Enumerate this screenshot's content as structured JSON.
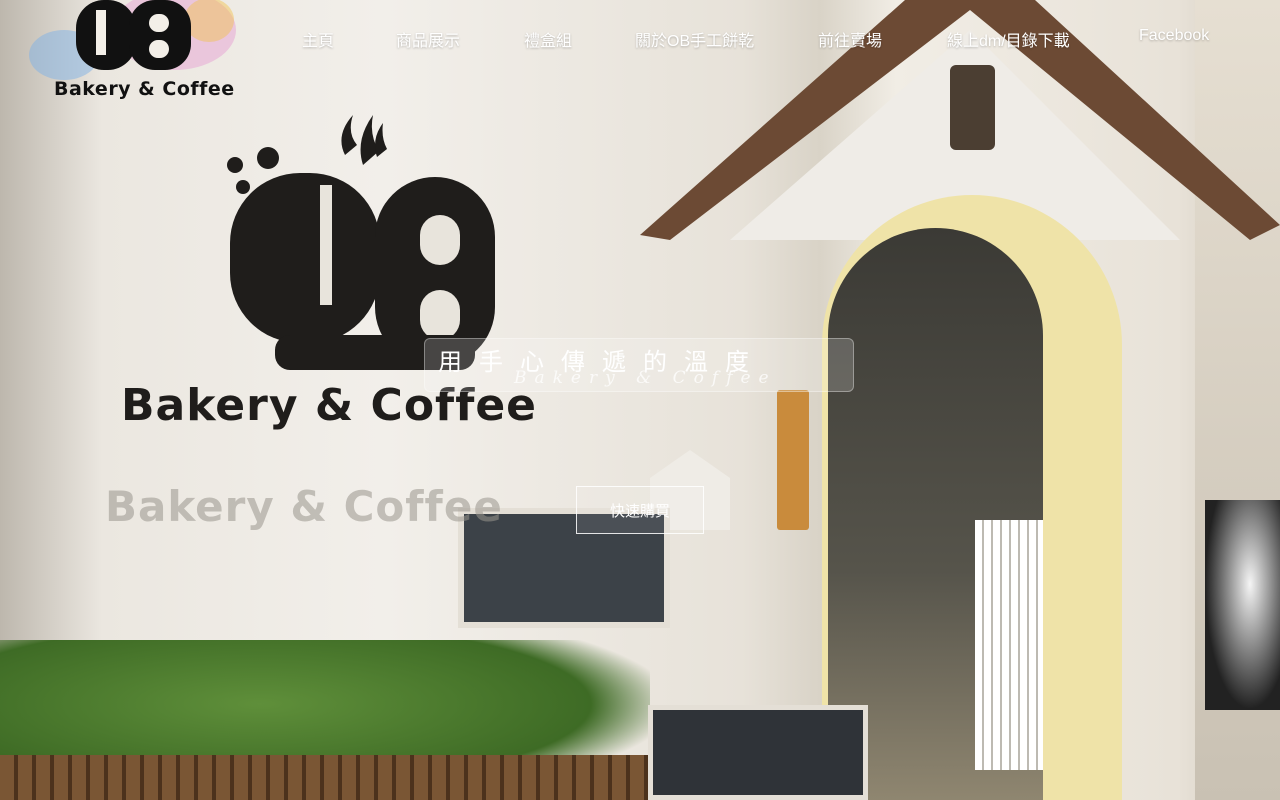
{
  "nav": {
    "items": [
      {
        "label": "主頁"
      },
      {
        "label": "商品展示"
      },
      {
        "label": "禮盒組"
      },
      {
        "label": "關於OB手工餅乾"
      },
      {
        "label": "前往賣場"
      },
      {
        "label": "線上dm/目錄下載"
      },
      {
        "label": "Facebook"
      }
    ]
  },
  "logo": {
    "text": "Bakery & Coffee"
  },
  "hero": {
    "sign_text": "Bakery & Coffee",
    "tagline": "用手心傳遞的溫度",
    "tagline_sub": "Bakery & Coffee",
    "cta_label": "快速購買"
  },
  "colors": {
    "nav_text": "#ffffff",
    "sign": "#1f1d1b",
    "arch": "#efe3a8"
  }
}
